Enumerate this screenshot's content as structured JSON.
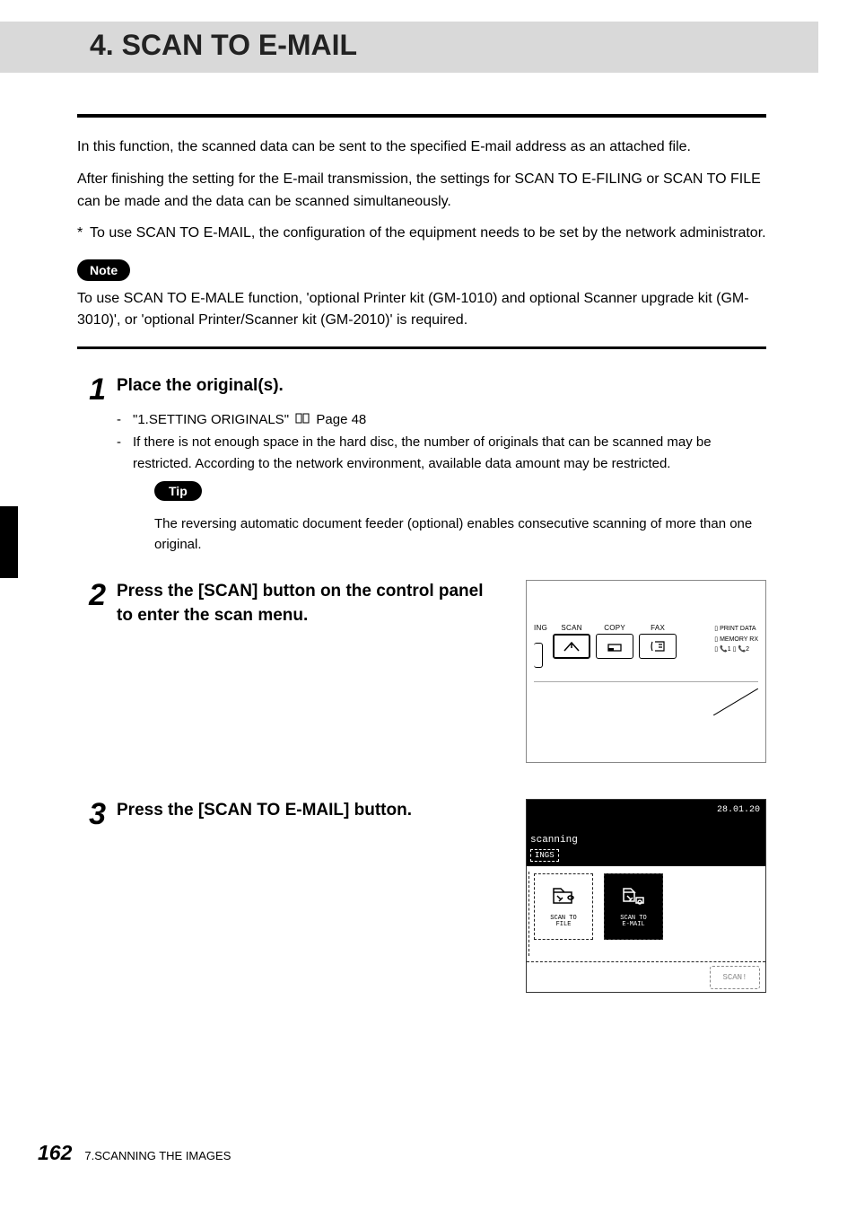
{
  "chapter": {
    "title": "4. SCAN TO E-MAIL"
  },
  "intro": {
    "paragraph1": "In this function, the scanned data can be sent to the specified E-mail address as an attached file.",
    "paragraph2": "After finishing the setting for the E-mail transmission, the settings for SCAN TO E-FILING or SCAN TO FILE can be made and the data can be scanned simultaneously.",
    "bullet": "To use SCAN TO E-MAIL, the configuration of the equipment needs to be set by the network administrator."
  },
  "note": {
    "label": "Note",
    "text": "To use SCAN TO E-MALE function, 'optional Printer kit (GM-1010) and optional Scanner upgrade kit (GM-3010)', or 'optional Printer/Scanner kit (GM-2010)' is required."
  },
  "steps": {
    "1": {
      "num": "1",
      "heading": "Place the original(s).",
      "item1_prefix": "\"1.SETTING ORIGINALS\"",
      "item1_suffix": "Page 48",
      "item2": "If there is not enough space in the hard disc, the number of originals that can be scanned may be restricted. According to the network environment, available data amount may be restricted.",
      "tip_label": "Tip",
      "tip_text": "The reversing automatic document feeder (optional) enables consecutive scanning of more than one original."
    },
    "2": {
      "num": "2",
      "heading": "Press the [SCAN] button on the control panel to enter the scan menu."
    },
    "3": {
      "num": "3",
      "heading": "Press the [SCAN TO E-MAIL] button."
    }
  },
  "panel": {
    "btn_ing": "ING",
    "btn_scan": "SCAN",
    "btn_copy": "COPY",
    "btn_fax": "FAX",
    "led_print": "PRINT DATA",
    "led_memory": "MEMORY RX",
    "led_l1": "1",
    "led_l2": "2"
  },
  "screen": {
    "date": "28.01.20",
    "status": "scanning",
    "ings": "INGS",
    "option_file": "SCAN TO\nFILE",
    "option_email": "SCAN TO\nE-MAIL",
    "footer_btn": "SCAN!"
  },
  "footer": {
    "page": "162",
    "chapter": "7.SCANNING THE IMAGES"
  }
}
